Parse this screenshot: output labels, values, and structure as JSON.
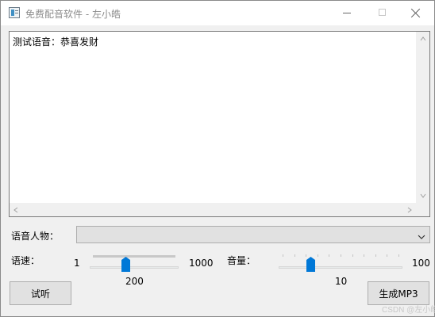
{
  "window": {
    "title": "免费配音软件 - 左小皓"
  },
  "text_area": {
    "content": "测试语音：恭喜发财"
  },
  "voice": {
    "label": "语音人物：",
    "selected": ""
  },
  "speed": {
    "label": "语速：",
    "min": "1",
    "max": "1000",
    "value": "200",
    "level": 0.2
  },
  "volume": {
    "label": "音量：",
    "min": "1",
    "max": "100",
    "value": "10",
    "level": 0.1
  },
  "buttons": {
    "preview": "试听",
    "generate": "生成MP3"
  },
  "watermark": "CSDN @左小皓",
  "colors": {
    "accent": "#0078d7",
    "window_bg": "#f0f0f0"
  }
}
